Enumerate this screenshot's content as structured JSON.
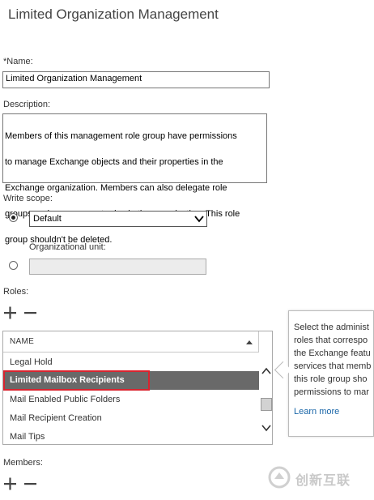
{
  "form": {
    "title": "Limited Organization Management",
    "name_label": "*Name:",
    "name_value": "Limited Organization Management",
    "description_label": "Description:",
    "description_lines": [
      "Members of this management role group have permissions",
      "to manage Exchange objects and their properties in the",
      "Exchange organization. Members can also delegate role",
      "groups and management roles in the organization. This role",
      "group shouldn't be deleted."
    ],
    "write_scope_label": "Write scope:",
    "write_scope_value": "Default",
    "write_scope_selected": true,
    "ou_label": "Organizational unit:",
    "ou_value": "",
    "roles_label": "Roles:",
    "members_label": "Members:"
  },
  "roles_table": {
    "header": "NAME",
    "rows": [
      "Legal Hold",
      "Limited Mailbox Recipients",
      "Mail Enabled Public Folders",
      "Mail Recipient Creation",
      "Mail Tips"
    ],
    "selected_index": 1
  },
  "tooltip": {
    "lines": [
      "Select the administ",
      "roles that correspo",
      "the Exchange featu",
      "services that memb",
      "this role group sho",
      "permissions to mar"
    ],
    "link": "Learn more"
  },
  "icons": {
    "add": "plus-icon",
    "remove": "minus-icon",
    "dropdown": "chevron-down-icon",
    "scroll_up": "chevron-up-icon",
    "scroll_down": "chevron-down-icon"
  },
  "colors": {
    "selected_row": "#696969",
    "highlight_border": "#d9242f",
    "link": "#1a66a8"
  },
  "watermark": {
    "text": "创新互联"
  }
}
